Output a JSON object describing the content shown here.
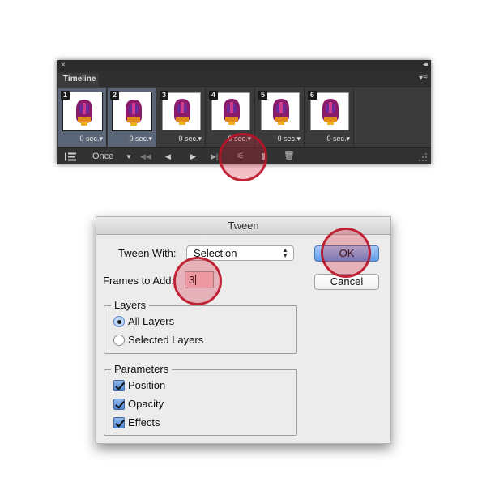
{
  "timeline": {
    "title": "Timeline",
    "close_glyph": "×",
    "collapse_glyph": "◂◂",
    "menu_glyph": "▾≡",
    "frames": [
      {
        "number": "1",
        "delay": "0 sec.",
        "selected": true
      },
      {
        "number": "2",
        "delay": "0 sec.",
        "selected": true
      },
      {
        "number": "3",
        "delay": "0 sec.",
        "selected": false
      },
      {
        "number": "4",
        "delay": "0 sec.",
        "selected": false
      },
      {
        "number": "5",
        "delay": "0 sec.",
        "selected": false
      },
      {
        "number": "6",
        "delay": "0 sec.",
        "selected": false
      }
    ],
    "controls": {
      "loop_option": "Once",
      "loop_arrow": "▼",
      "first_frame": "◀◀",
      "prev_frame": "◀",
      "play": "▶",
      "next_frame": "▶|",
      "tween": "⚟",
      "duplicate": "▮",
      "delete": "🗑"
    }
  },
  "tween_dialog": {
    "title": "Tween",
    "tween_with_label": "Tween With:",
    "tween_with_value": "Selection",
    "frames_to_add_label": "Frames to Add:",
    "frames_to_add_value": "3",
    "layers_group": {
      "title": "Layers",
      "options": [
        {
          "label": "All Layers",
          "checked": true
        },
        {
          "label": "Selected Layers",
          "checked": false
        }
      ]
    },
    "parameters_group": {
      "title": "Parameters",
      "options": [
        {
          "label": "Position",
          "checked": true
        },
        {
          "label": "Opacity",
          "checked": true
        },
        {
          "label": "Effects",
          "checked": true
        }
      ]
    },
    "ok_label": "OK",
    "cancel_label": "Cancel"
  },
  "colors": {
    "highlight": "#c8142b",
    "panel_bg": "#3b3b3b",
    "selected_frame": "#5a6677",
    "ok_button": "#5d9ae7",
    "input_highlight": "#f8c6cc"
  }
}
